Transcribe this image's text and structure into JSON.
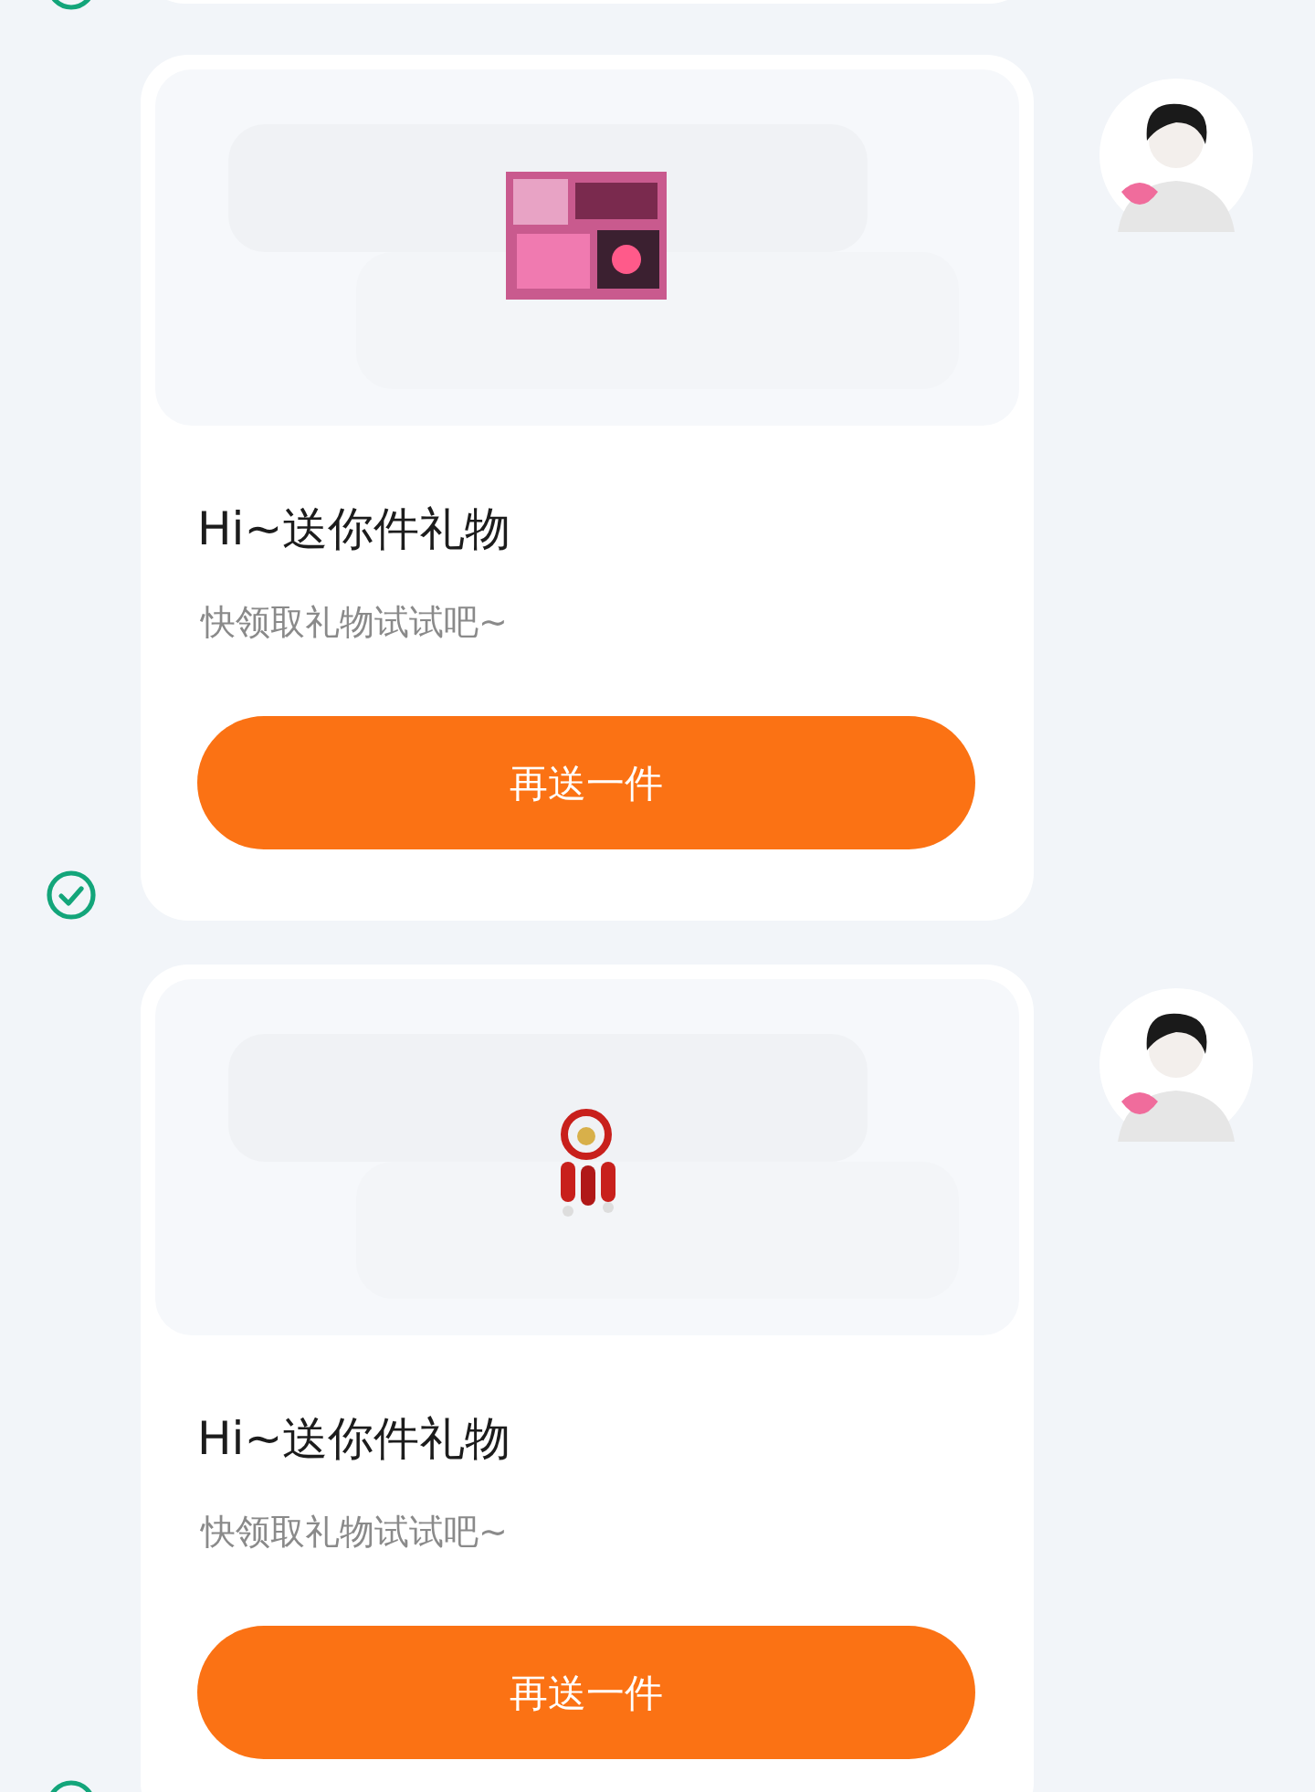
{
  "previous_message": {
    "sent": true
  },
  "messages": [
    {
      "sent": true,
      "title": "Hi~送你件礼物",
      "subtitle": "快领取礼物试试吧~",
      "button": "再送一件"
    },
    {
      "sent": true,
      "title": "Hi~送你件礼物",
      "subtitle": "快领取礼物试试吧~",
      "button": "再送一件"
    }
  ]
}
